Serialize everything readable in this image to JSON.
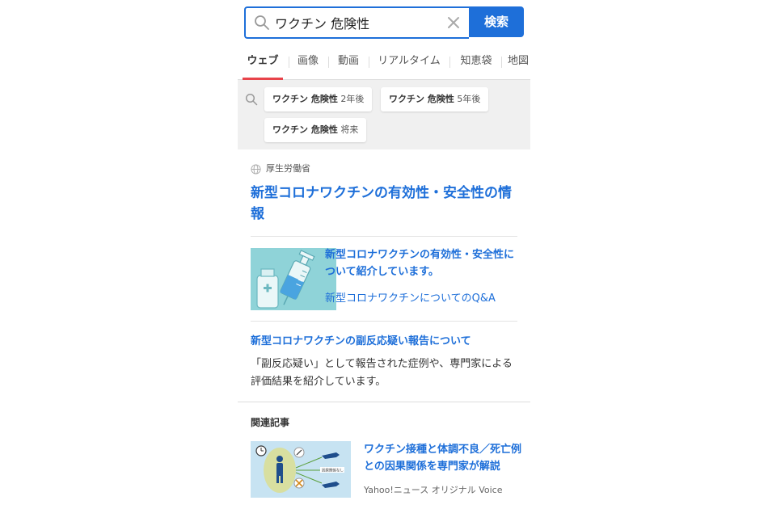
{
  "search": {
    "query": "ワクチン 危険性",
    "button_label": "検索"
  },
  "tabs": [
    {
      "label": "ウェブ",
      "active": true
    },
    {
      "label": "画像"
    },
    {
      "label": "動画"
    },
    {
      "label": "リアルタイム"
    },
    {
      "label": "知恵袋"
    },
    {
      "label": "地図"
    }
  ],
  "suggestions": [
    {
      "bold": "ワクチン 危険性",
      "rest": "2年後"
    },
    {
      "bold": "ワクチン 危険性",
      "rest": "5年後"
    },
    {
      "bold": "ワクチン 危険性",
      "rest": "将来"
    }
  ],
  "result": {
    "site_name": "厚生労働省",
    "title": "新型コロナワクチンの有効性・安全性の情報",
    "sub_title": "新型コロナワクチンの有効性・安全性について紹介しています。",
    "sub_link": "新型コロナワクチンについてのQ&A",
    "sub_title2": "新型コロナワクチンの副反応疑い報告について",
    "snippet": "「副反応疑い」として報告された症例や、専門家による評価結果を紹介しています。"
  },
  "related": {
    "heading": "関連記事",
    "article_title": "ワクチン接種と体調不良／死亡例との因果関係を専門家が解説",
    "article_source": "Yahoo!ニュース オリジナル Voice",
    "thumb_caption": "因果関係なし"
  },
  "colors": {
    "accent": "#1e6fd9",
    "tab_underline": "#e8434a",
    "thumb1_bg": "#8fd3d8",
    "thumb2_bg": "#c7e3f2"
  }
}
